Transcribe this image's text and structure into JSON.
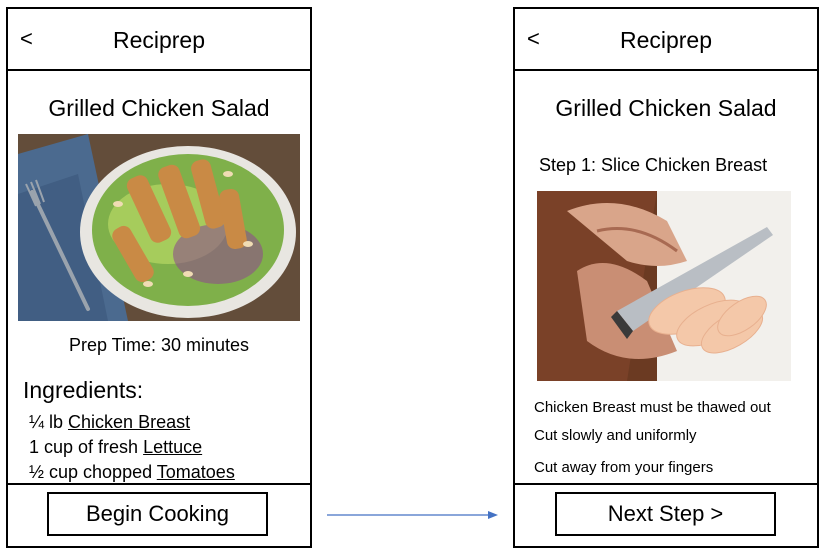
{
  "screen_left": {
    "header": {
      "back_label": "<",
      "title": "Reciprep"
    },
    "recipe_title": "Grilled Chicken Salad",
    "prep_time": "Prep Time: 30 minutes",
    "ingredients_heading": "Ingredients:",
    "ingredients": [
      {
        "amount": "¼ lb ",
        "name": "Chicken Breast"
      },
      {
        "amount": "1 cup of fresh ",
        "name": "Lettuce"
      },
      {
        "amount": "½ cup chopped ",
        "name": "Tomatoes"
      }
    ],
    "button_label": "Begin Cooking"
  },
  "screen_right": {
    "header": {
      "back_label": "<",
      "title": "Reciprep"
    },
    "recipe_title": "Grilled Chicken Salad",
    "step_title": "Step 1: Slice Chicken Breast",
    "tips": [
      "Chicken Breast must be thawed out",
      "Cut slowly and uniformly",
      "Cut away from your fingers"
    ],
    "button_label": "Next Step >"
  },
  "colors": {
    "arrow": "#4472c4",
    "border": "#000000"
  },
  "icons": {
    "back": "chevron-left-icon",
    "flow": "arrow-right-icon"
  }
}
